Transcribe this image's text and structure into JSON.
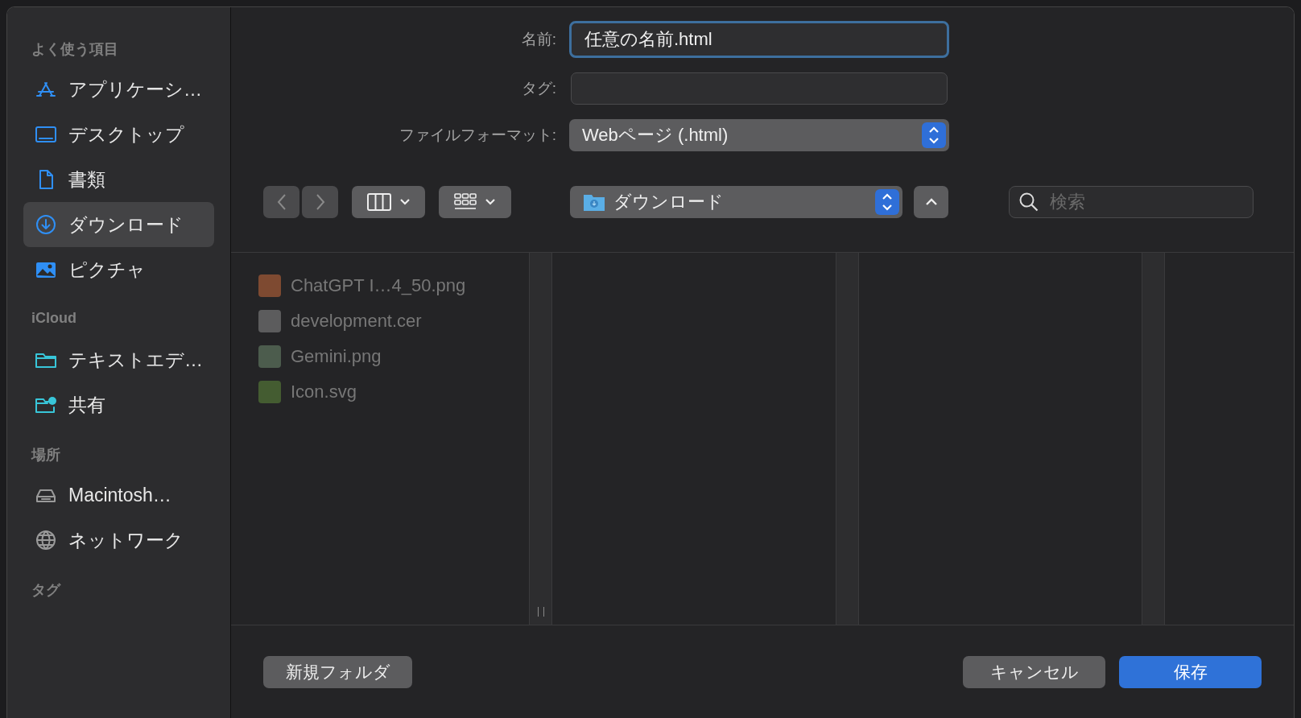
{
  "sidebar": {
    "sections": [
      {
        "heading": "よく使う項目",
        "items": [
          {
            "label": "アプリケーシ…",
            "selected": false
          },
          {
            "label": "デスクトップ",
            "selected": false
          },
          {
            "label": "書類",
            "selected": false
          },
          {
            "label": "ダウンロード",
            "selected": true
          },
          {
            "label": "ピクチャ",
            "selected": false
          }
        ]
      },
      {
        "heading": "iCloud",
        "items": [
          {
            "label": "テキストエデ…",
            "selected": false
          },
          {
            "label": "共有",
            "selected": false
          }
        ]
      },
      {
        "heading": "場所",
        "items": [
          {
            "label": "Macintosh…",
            "selected": false
          },
          {
            "label": "ネットワーク",
            "selected": false
          }
        ]
      },
      {
        "heading": "タグ"
      }
    ]
  },
  "form": {
    "name": {
      "label": "名前:",
      "value": "任意の名前.html",
      "focused": true
    },
    "tags": {
      "label": "タグ:"
    },
    "format": {
      "label": "ファイルフォーマット:",
      "value": "Webページ (.html)"
    }
  },
  "toolbar": {
    "location": "ダウンロード",
    "search": {
      "placeholder": "検索"
    }
  },
  "files": [
    {
      "name": "ChatGPT I…4_50.png",
      "disabled": true
    },
    {
      "name": "development.cer",
      "disabled": true
    },
    {
      "name": "Gemini.png",
      "disabled": true
    },
    {
      "name": "Icon.svg",
      "disabled": true
    }
  ],
  "buttons": [
    {
      "label": "新規フォルダ",
      "kind": "secondary"
    },
    {
      "label": "キャンセル",
      "kind": "secondary"
    },
    {
      "label": "保存",
      "kind": "primary"
    }
  ]
}
